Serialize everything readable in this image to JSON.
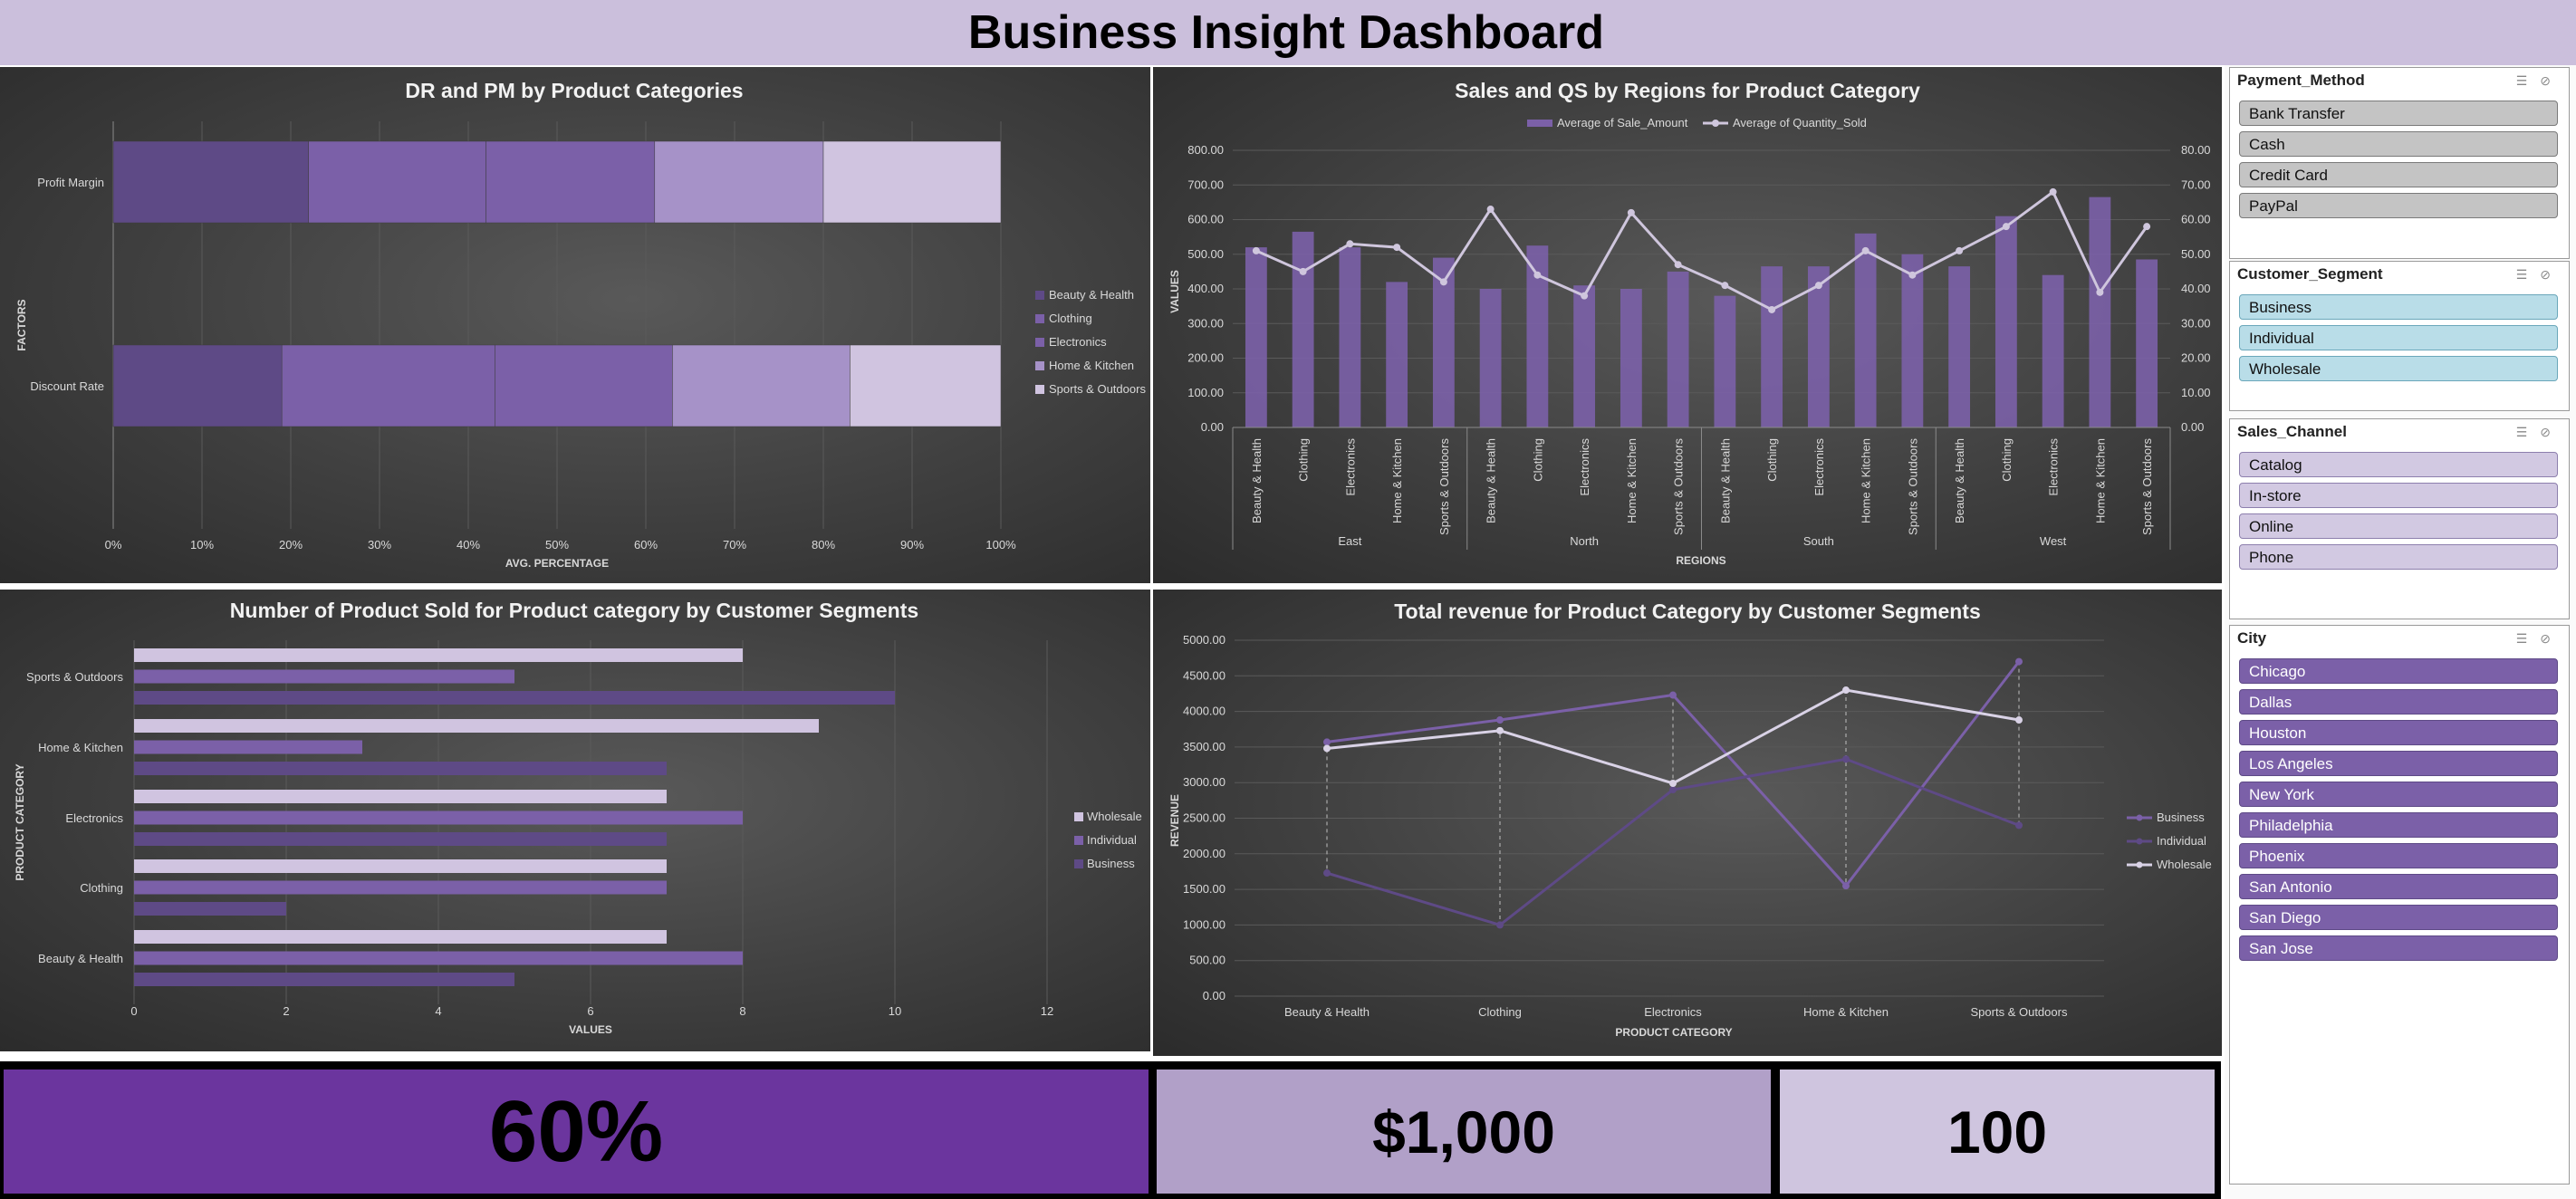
{
  "dashboard": {
    "title": "Business Insight Dashboard"
  },
  "colors": {
    "purple_dark": "#5e4a86",
    "purple_mid": "#7b60a8",
    "purple_light": "#a692c8",
    "purple_pale": "#d0c4e0",
    "kpi1_bg": "#6b359e",
    "kpi2_bg": "#b1a0c8",
    "kpi3_bg": "#cfc5df",
    "title_bar": "#cbbfdc"
  },
  "kpis": {
    "kpi1": "60%",
    "kpi2": "$1,000",
    "kpi3": "100"
  },
  "slicers": {
    "payment_method": {
      "title": "Payment_Method",
      "items": [
        "Bank Transfer",
        "Cash",
        "Credit Card",
        "PayPal"
      ],
      "icons": [
        "multi-select-icon",
        "clear-filter-icon"
      ]
    },
    "customer_segment": {
      "title": "Customer_Segment",
      "items": [
        "Business",
        "Individual",
        "Wholesale"
      ],
      "icons": [
        "multi-select-icon",
        "clear-filter-icon"
      ]
    },
    "sales_channel": {
      "title": "Sales_Channel",
      "items": [
        "Catalog",
        "In-store",
        "Online",
        "Phone"
      ],
      "icons": [
        "multi-select-icon",
        "clear-filter-icon"
      ]
    },
    "city": {
      "title": "City",
      "items": [
        "Chicago",
        "Dallas",
        "Houston",
        "Los Angeles",
        "New York",
        "Philadelphia",
        "Phoenix",
        "San Antonio",
        "San Diego",
        "San Jose"
      ],
      "icons": [
        "multi-select-icon",
        "clear-filter-icon"
      ]
    }
  },
  "chart_data": [
    {
      "id": "dr_pm",
      "type": "bar",
      "subtype": "100% stacked horizontal",
      "title": "DR and PM by Product Categories",
      "xlabel": "AVG. PERCENTAGE",
      "ylabel": "FACTORS",
      "categories": [
        "Profit Margin",
        "Discount Rate"
      ],
      "xticks": [
        "0%",
        "10%",
        "20%",
        "30%",
        "40%",
        "50%",
        "60%",
        "70%",
        "80%",
        "90%",
        "100%"
      ],
      "series": [
        {
          "name": "Beauty & Health",
          "values": [
            22,
            19
          ]
        },
        {
          "name": "Clothing",
          "values": [
            20,
            24
          ]
        },
        {
          "name": "Electronics",
          "values": [
            19,
            20
          ]
        },
        {
          "name": "Home & Kitchen",
          "values": [
            19,
            20
          ]
        },
        {
          "name": "Sports & Outdoors",
          "values": [
            20,
            17
          ]
        }
      ],
      "legend": "right",
      "grid": true
    },
    {
      "id": "sales_qs",
      "type": "bar",
      "subtype": "combo bar + line, dual axis",
      "title": "Sales and QS by Regions for Product Category",
      "xlabel": "REGIONS",
      "ylabel": "VALUES",
      "regions": [
        "East",
        "North",
        "South",
        "West"
      ],
      "subcategories": [
        "Beauty & Health",
        "Clothing",
        "Electronics",
        "Home & Kitchen",
        "Sports & Outdoors"
      ],
      "y_ticks": [
        "0.00",
        "100.00",
        "200.00",
        "300.00",
        "400.00",
        "500.00",
        "600.00",
        "700.00",
        "800.00"
      ],
      "y2_ticks": [
        "0.00",
        "10.00",
        "20.00",
        "30.00",
        "40.00",
        "50.00",
        "60.00",
        "70.00",
        "80.00"
      ],
      "ylim": [
        0,
        800
      ],
      "y2lim": [
        0,
        80
      ],
      "series": [
        {
          "name": "Average of Sale_Amount",
          "kind": "bar",
          "values": [
            520,
            565,
            520,
            420,
            490,
            400,
            525,
            410,
            400,
            450,
            380,
            465,
            465,
            560,
            500,
            465,
            610,
            440,
            665,
            485
          ]
        },
        {
          "name": "Average of Quantity_Sold",
          "kind": "line",
          "axis": "right",
          "values": [
            51,
            45,
            53,
            52,
            42,
            63,
            44,
            38,
            62,
            47,
            41,
            34,
            41,
            51,
            44,
            51,
            58,
            68,
            39,
            58
          ]
        }
      ],
      "legend": "top",
      "grid": true
    },
    {
      "id": "num_sold",
      "type": "bar",
      "subtype": "clustered horizontal",
      "title": "Number of Product Sold for Product category by Customer Segments",
      "xlabel": "VALUES",
      "ylabel": "PRODUCT CATEGORY",
      "categories": [
        "Beauty & Health",
        "Clothing",
        "Electronics",
        "Home & Kitchen",
        "Sports & Outdoors"
      ],
      "xticks": [
        "0",
        "2",
        "4",
        "6",
        "8",
        "10",
        "12"
      ],
      "xlim": [
        0,
        12
      ],
      "series": [
        {
          "name": "Business",
          "values": [
            5,
            2,
            7,
            7,
            10
          ]
        },
        {
          "name": "Individual",
          "values": [
            8,
            7,
            8,
            3,
            5
          ]
        },
        {
          "name": "Wholesale",
          "values": [
            7,
            7,
            7,
            9,
            8
          ]
        }
      ],
      "legend": "right",
      "grid": true
    },
    {
      "id": "revenue",
      "type": "line",
      "title": "Total revenue for Product Category by Customer Segments",
      "xlabel": "PRODUCT CATEGORY",
      "ylabel": "REVENUE",
      "categories": [
        "Beauty & Health",
        "Clothing",
        "Electronics",
        "Home & Kitchen",
        "Sports & Outdoors"
      ],
      "y_ticks": [
        "0.00",
        "500.00",
        "1000.00",
        "1500.00",
        "2000.00",
        "2500.00",
        "3000.00",
        "3500.00",
        "4000.00",
        "4500.00",
        "5000.00"
      ],
      "ylim": [
        0,
        5000
      ],
      "series": [
        {
          "name": "Business",
          "values": [
            3570,
            3880,
            4230,
            1550,
            4700
          ]
        },
        {
          "name": "Individual",
          "values": [
            1730,
            1000,
            2900,
            3330,
            2400
          ]
        },
        {
          "name": "Wholesale",
          "values": [
            3480,
            3730,
            2990,
            4300,
            3880
          ]
        }
      ],
      "legend": "right",
      "grid": true
    }
  ]
}
